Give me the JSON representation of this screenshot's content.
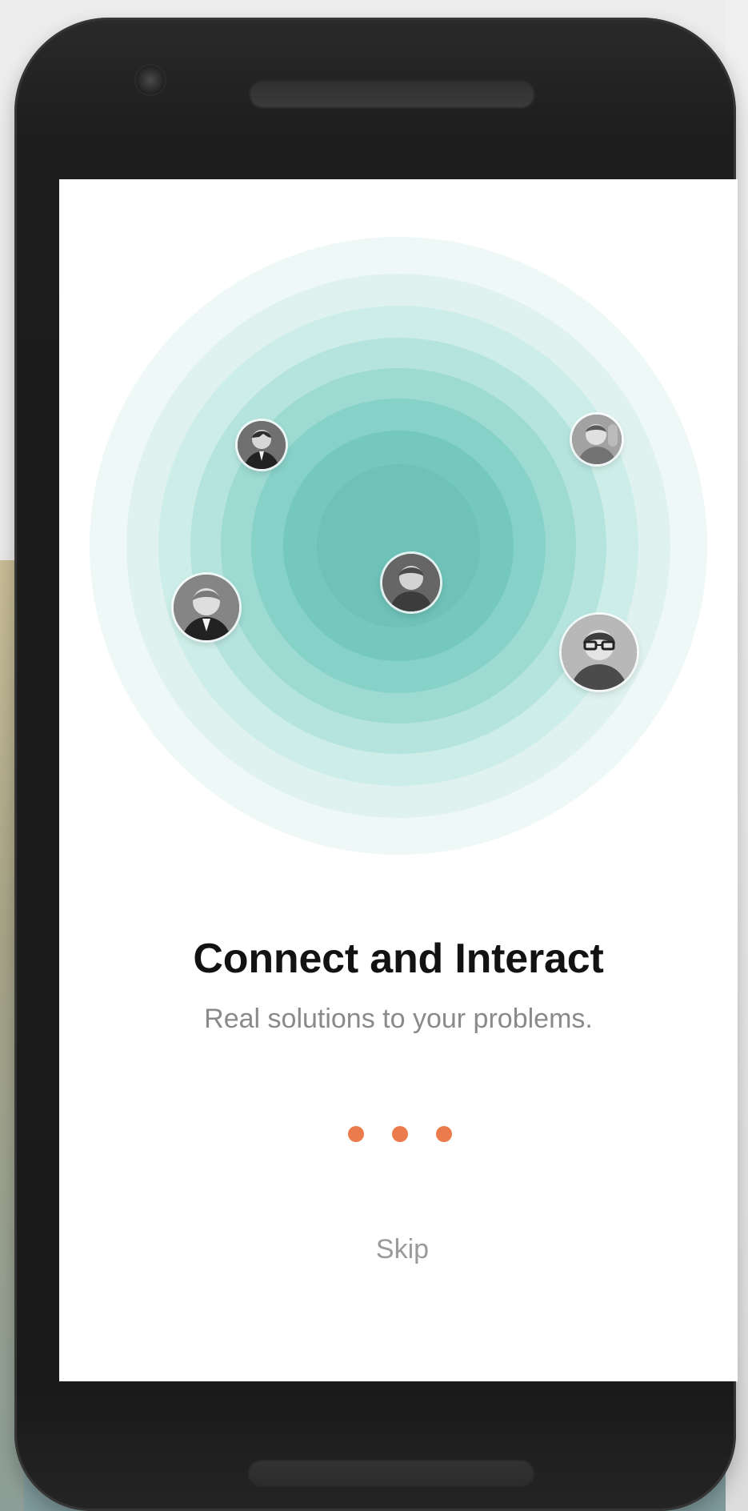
{
  "onboarding": {
    "title": "Connect and Interact",
    "subtitle": "Real solutions to your problems.",
    "skip_label": "Skip"
  },
  "pagination": {
    "pages": 3,
    "accent": "#eb7b4d"
  },
  "palette": {
    "ring_outer": "#edf8f7",
    "ring_inner": "#6ec8be",
    "screen_bg": "#ffffff",
    "phone_body": "#1d1d1d"
  }
}
